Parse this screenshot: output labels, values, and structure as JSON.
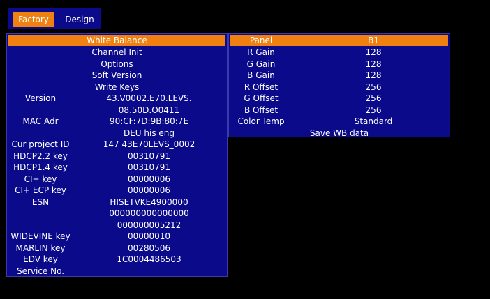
{
  "tabs": {
    "factory": "Factory",
    "design": "Design"
  },
  "left_menu": {
    "white_balance": "White Balance",
    "channel_init": "Channel Init",
    "options": "Options",
    "soft_version": "Soft Version",
    "write_keys": "Write Keys"
  },
  "info": {
    "version_label": "Version",
    "version_line1": "43.V0002.E70.LEVS.",
    "version_line2": "08.50D.O0411",
    "mac_label": "MAC Adr",
    "mac_value": "90:CF:7D:9B:80:7E",
    "lang_value": "DEU his eng",
    "project_label": "Cur project ID",
    "project_value": "147 43E70LEVS_0002",
    "hdcp22_label": "HDCP2.2 key",
    "hdcp22_value": "00310791",
    "hdcp14_label": "HDCP1.4 key",
    "hdcp14_value": "00310791",
    "ciplus_label": "CI+ key",
    "ciplus_value": "00000006",
    "ciplus_ecp_label": "CI+ ECP key",
    "ciplus_ecp_value": "00000006",
    "esn_label": "ESN",
    "esn_line1": "HISETVKE4900000",
    "esn_line2": "000000000000000",
    "esn_line3": "000000005212",
    "widevine_label": "WIDEVINE key",
    "widevine_value": "00000010",
    "marlin_label": "MARLIN key",
    "marlin_value": "00280506",
    "edv_label": "EDV key",
    "edv_value": "1C0004486503",
    "service_label": "Service No."
  },
  "white_balance": {
    "panel_label": "Panel",
    "panel_value": "B1",
    "r_gain_label": "R Gain",
    "r_gain_value": "128",
    "g_gain_label": "G Gain",
    "g_gain_value": "128",
    "b_gain_label": "B Gain",
    "b_gain_value": "128",
    "r_offset_label": "R Offset",
    "r_offset_value": "256",
    "g_offset_label": "G Offset",
    "g_offset_value": "256",
    "b_offset_label": "B Offset",
    "b_offset_value": "256",
    "color_temp_label": "Color Temp",
    "color_temp_value": "Standard",
    "save_label": "Save WB data"
  },
  "colors": {
    "panel_bg": "#0a0a8a",
    "highlight": "#f08010",
    "screen_bg": "#000000",
    "text": "#ffffff"
  }
}
